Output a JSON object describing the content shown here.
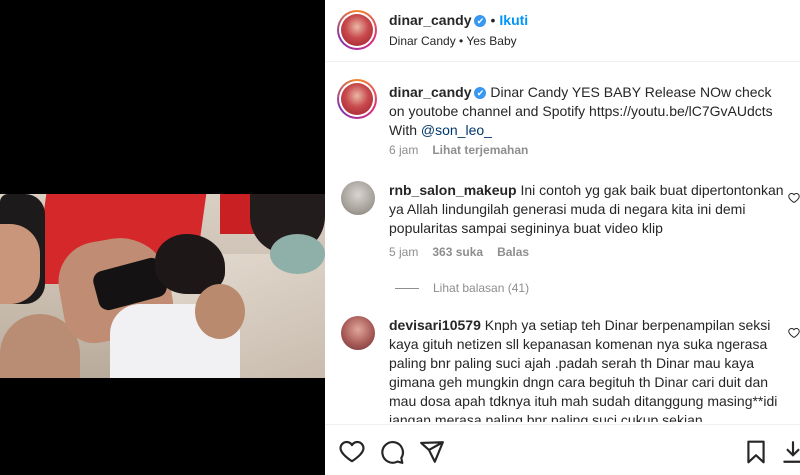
{
  "post": {
    "username": "dinar_candy",
    "follow_label": "Ikuti",
    "dot": "•",
    "subtitle": "Dinar Candy • Yes Baby"
  },
  "caption": {
    "username": "dinar_candy",
    "text": "Dinar Candy YES BABY Release NOw check on youtobe channel and Spotify https://youtu.be/lC7GvAUdcts With ",
    "mention": "@son_leo_",
    "time": "6 jam",
    "translate_label": "Lihat terjemahan"
  },
  "comments": [
    {
      "username": "rnb_salon_makeup",
      "text": "Ini contoh yg gak baik buat dipertontonkan ya Allah lindungilah generasi muda di negara kita ini demi popularitas sampai segininya buat video klip",
      "time": "5 jam",
      "likes": "363 suka",
      "reply_label": "Balas",
      "view_replies": "Lihat balasan (41)"
    },
    {
      "username": "devisari10579",
      "text": "Knph ya setiap teh Dinar berpenampilan seksi kaya gituh netizen sll kepanasan komenan nya suka ngerasa paling bnr paling suci ajah .padah serah th Dinar mau kaya gimana geh mungkin dngn cara begituh th Dinar cari duit dan mau dosa apah tdknya ituh mah sudah ditanggung masing**idi jangan merasa paling bnr paling suci cukup sekian"
    }
  ],
  "icons": {
    "verified": "✔",
    "like": "heart-icon",
    "comment": "comment-icon",
    "share": "share-icon",
    "save": "bookmark-icon",
    "more": "more-icon"
  },
  "colors": {
    "accent": "#0095f6",
    "verified": "#3897f0",
    "mention": "#00376b",
    "muted": "#8e8e8e"
  }
}
